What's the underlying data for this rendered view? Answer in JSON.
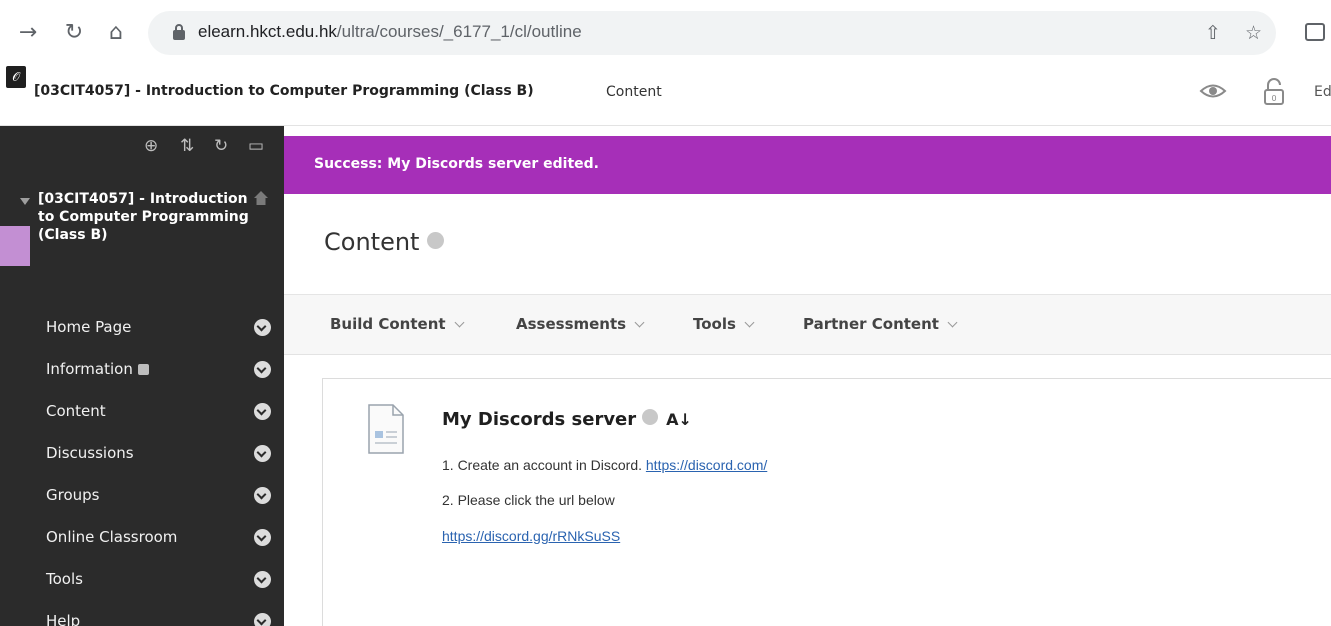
{
  "browser": {
    "url_host": "elearn.hkct.edu.hk",
    "url_path": "/ultra/courses/_6177_1/cl/outline"
  },
  "header": {
    "edit_badge": "𝒪",
    "course_title": "[03CIT4057] - Introduction to Computer Programming (Class B)",
    "crumb": "Content",
    "edit_label": "Ed"
  },
  "sidebar": {
    "course_name": "[03CIT4057] - Introduction to Computer Programming (Class B)",
    "items": [
      {
        "label": "Home Page"
      },
      {
        "label": "Information"
      },
      {
        "label": "Content"
      },
      {
        "label": "Discussions"
      },
      {
        "label": "Groups"
      },
      {
        "label": "Online Classroom"
      },
      {
        "label": "Tools"
      },
      {
        "label": "Help"
      }
    ]
  },
  "main": {
    "success_message": "Success: My Discords server edited.",
    "page_title": "Content",
    "toolbar": [
      {
        "label": "Build Content"
      },
      {
        "label": "Assessments"
      },
      {
        "label": "Tools"
      },
      {
        "label": "Partner Content"
      }
    ],
    "item": {
      "title": "My Discords server",
      "line1_text": "1. Create an account in Discord.",
      "line1_link": "https://discord.com/",
      "line2_text": "2.  Please click the url below",
      "line3_link": "https://discord.gg/rRNkSuSS"
    }
  },
  "colors": {
    "success_bar": "#a62fb8",
    "sidebar_bg": "#2b2b2b",
    "link": "#2a63b0"
  }
}
